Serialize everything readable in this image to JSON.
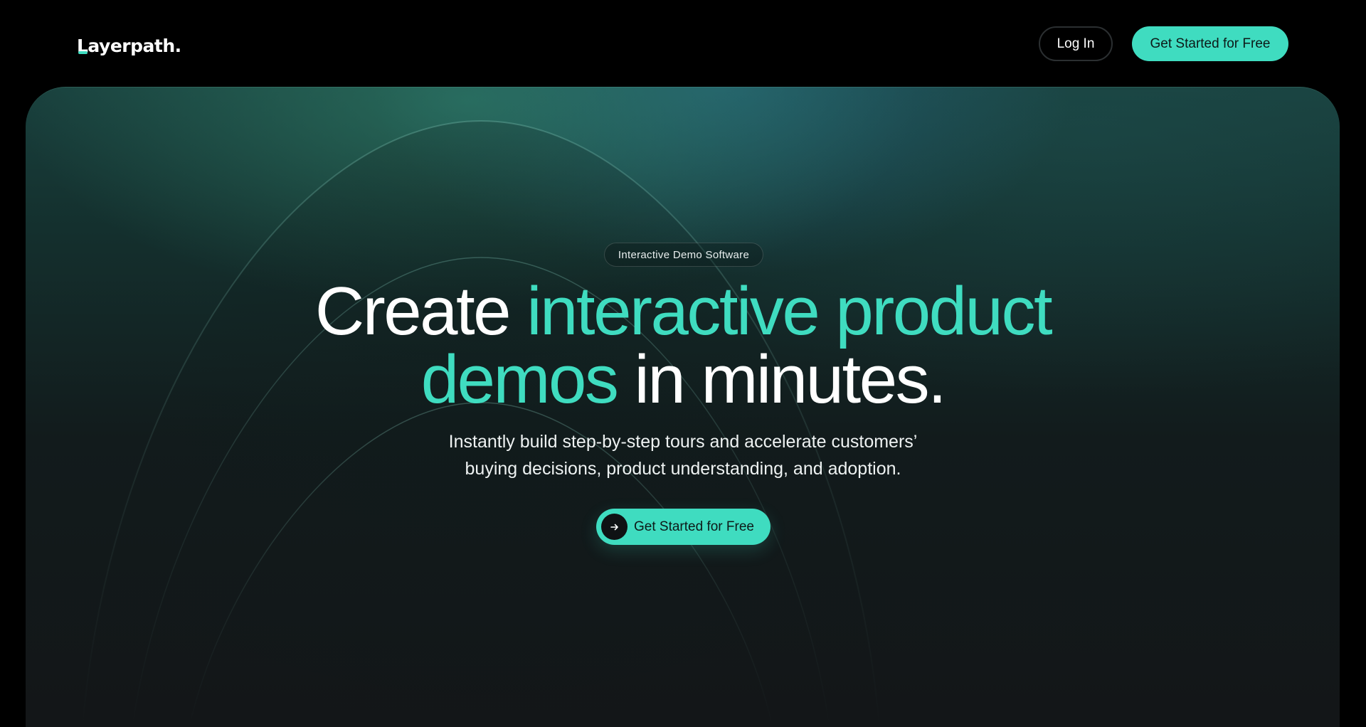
{
  "header": {
    "logo_text": "Layerpath.",
    "login_label": "Log In",
    "cta_label": "Get Started for Free"
  },
  "hero": {
    "badge": "Interactive Demo Software",
    "headline": {
      "line1_plain": "Create ",
      "line1_accent": "interactive product",
      "line2_accent": "demos",
      "line2_plain": " in minutes."
    },
    "subtitle": {
      "line1": "Instantly build step-by-step tours and accelerate customers’",
      "line2": "buying decisions, product understanding, and adoption."
    },
    "cta_label": "Get Started for Free"
  },
  "colors": {
    "accent": "#3fdcc0",
    "background": "#000000",
    "hero_bottom": "#131618"
  },
  "icons": {
    "cta_icon": "arrow-right-icon"
  }
}
